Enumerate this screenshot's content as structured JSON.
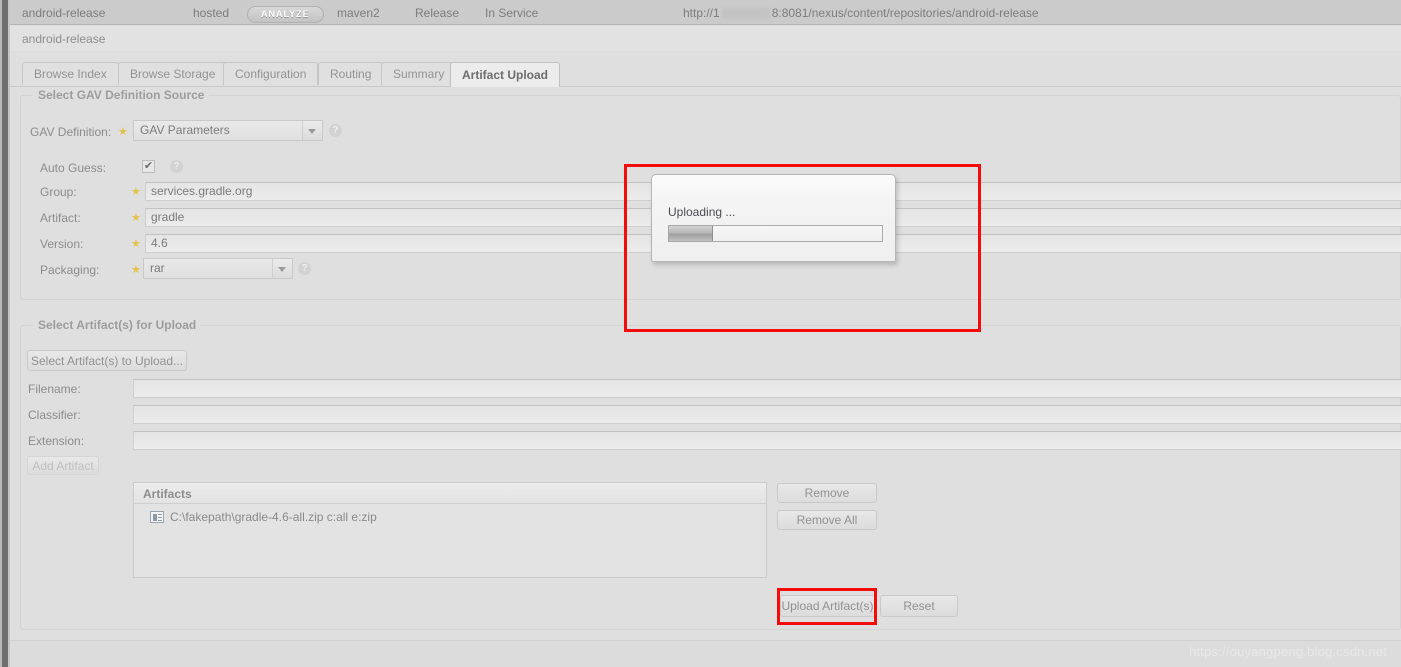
{
  "topbar": {
    "repo_name": "android-release",
    "repo_type": "hosted",
    "analyze_label": "ANALYZE",
    "format": "maven2",
    "policy": "Release",
    "status": "In Service",
    "url_prefix": "http://1",
    "url_suffix": "8:8081/nexus/content/repositories/android-release"
  },
  "repo_title": "android-release",
  "tabs": [
    {
      "label": "Browse Index",
      "active": false
    },
    {
      "label": "Browse Storage",
      "active": false
    },
    {
      "label": "Configuration",
      "active": false
    },
    {
      "label": "Routing",
      "active": false
    },
    {
      "label": "Summary",
      "active": false
    },
    {
      "label": "Artifact Upload",
      "active": true
    }
  ],
  "gav_section": {
    "legend": "Select GAV Definition Source",
    "gav_definition": {
      "label": "GAV Definition:",
      "value": "GAV Parameters",
      "help": "?"
    },
    "auto_guess": {
      "label": "Auto Guess:",
      "checked_glyph": "✔",
      "help": "?"
    },
    "group": {
      "label": "Group:",
      "value": "services.gradle.org"
    },
    "artifact": {
      "label": "Artifact:",
      "value": "gradle"
    },
    "version": {
      "label": "Version:",
      "value": "4.6"
    },
    "packaging": {
      "label": "Packaging:",
      "value": "rar",
      "help": "?"
    },
    "required_star": "★"
  },
  "artifact_section": {
    "legend": "Select Artifact(s) for Upload",
    "select_button": "Select Artifact(s) to Upload...",
    "filename": {
      "label": "Filename:",
      "value": ""
    },
    "classifier": {
      "label": "Classifier:",
      "value": ""
    },
    "extension": {
      "label": "Extension:",
      "value": ""
    },
    "add_artifact_button": "Add Artifact",
    "artifacts_header": "Artifacts",
    "artifacts_items": [
      "C:\\fakepath\\gradle-4.6-all.zip c:all e:zip"
    ],
    "remove_button": "Remove",
    "remove_all_button": "Remove All",
    "upload_button": "Upload Artifact(s)",
    "reset_button": "Reset"
  },
  "upload_dialog": {
    "title": "Uploading ...",
    "progress_percent": 20
  },
  "watermark": "https://ouyangpeng.blog.csdn.net",
  "colors": {
    "annotation_red": "#f20c0c",
    "page_background": "#dfdfdf",
    "required_star": "#e2c34a"
  }
}
